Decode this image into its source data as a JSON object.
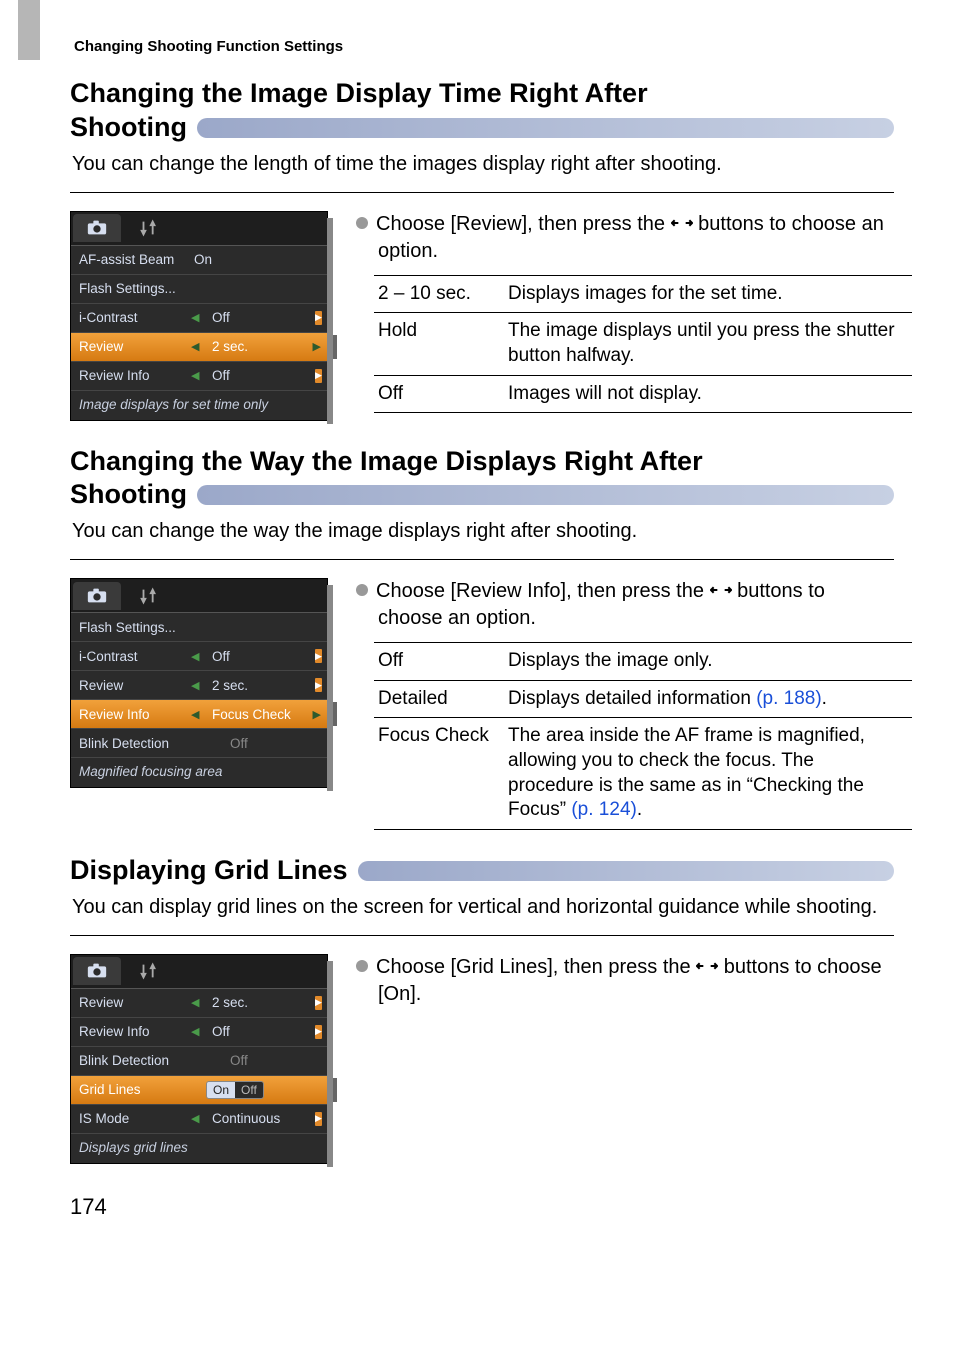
{
  "breadcrumb": "Changing Shooting Function Settings",
  "page_number": "174",
  "lr_arrows_alt": "left/right",
  "sections": {
    "s1": {
      "title_line1": "Changing the Image Display Time Right After",
      "title_line2": "Shooting",
      "lead": "You can change the length of time the images display right after shooting.",
      "instruction_a": "Choose [Review], then press the ",
      "instruction_b": " buttons to choose an option.",
      "lcd_footer": "Image displays for set time only",
      "menu": {
        "m1": {
          "label": "AF-assist Beam",
          "value": "On"
        },
        "m2": {
          "label": "Flash Settings...",
          "value": ""
        },
        "m3": {
          "label": "i-Contrast",
          "value": "Off"
        },
        "m4": {
          "label": "Review",
          "value": "2 sec."
        },
        "m5": {
          "label": "Review Info",
          "value": "Off"
        }
      },
      "table": {
        "r1": {
          "k": "2 – 10 sec.",
          "v": "Displays images for the set time."
        },
        "r2": {
          "k": "Hold",
          "v": "The image displays until you press the shutter button halfway."
        },
        "r3": {
          "k": "Off",
          "v": "Images will not display."
        }
      }
    },
    "s2": {
      "title_line1": "Changing the Way the Image Displays Right After",
      "title_line2": "Shooting",
      "lead": "You can change the way the image displays right after shooting.",
      "instruction_a": "Choose [Review Info], then press the ",
      "instruction_b": " buttons to choose an option.",
      "lcd_footer": "Magnified focusing area",
      "menu": {
        "m1": {
          "label": "Flash Settings...",
          "value": ""
        },
        "m2": {
          "label": "i-Contrast",
          "value": "Off"
        },
        "m3": {
          "label": "Review",
          "value": "2 sec."
        },
        "m4": {
          "label": "Review Info",
          "value": "Focus Check"
        },
        "m5": {
          "label": "Blink Detection",
          "value": "Off"
        }
      },
      "table": {
        "r1": {
          "k": "Off",
          "v": "Displays the image only."
        },
        "r2": {
          "k": "Detailed",
          "v1": "Displays detailed information ",
          "link": "(p. 188)",
          "v2": "."
        },
        "r3": {
          "k": "Focus Check",
          "v1": "The area inside the AF frame is magnified, allowing you to check the focus. The procedure is the same as in “Checking the Focus” ",
          "link": "(p. 124)",
          "v2": "."
        }
      }
    },
    "s3": {
      "title": "Displaying Grid Lines",
      "lead": "You can display grid lines on the screen for vertical and horizontal guidance while shooting.",
      "instruction_a": "Choose [Grid Lines], then press the ",
      "instruction_b": " buttons to choose [On].",
      "lcd_footer": "Displays grid lines",
      "menu": {
        "m1": {
          "label": "Review",
          "value": "2 sec."
        },
        "m2": {
          "label": "Review Info",
          "value": "Off"
        },
        "m3": {
          "label": "Blink Detection",
          "value": "Off"
        },
        "m4": {
          "label": "Grid Lines",
          "on": "On",
          "off": "Off"
        },
        "m5": {
          "label": "IS Mode",
          "value": "Continuous"
        }
      }
    }
  }
}
